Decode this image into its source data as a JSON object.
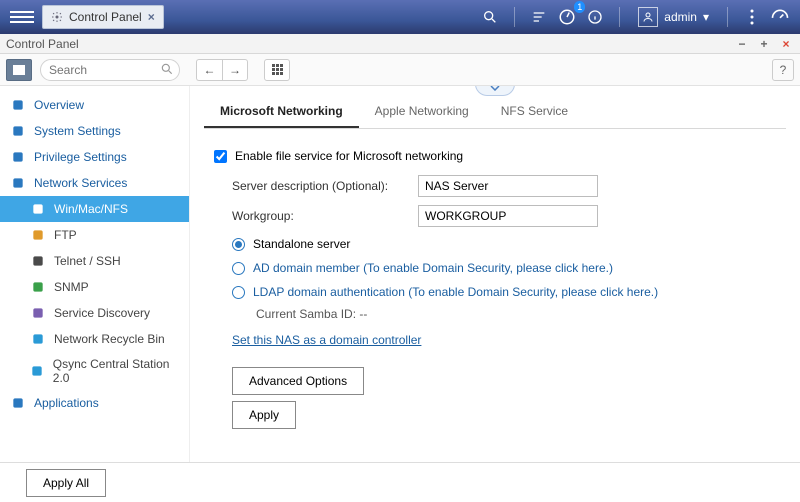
{
  "topbar": {
    "tab_label": "Control Panel",
    "user_name": "admin",
    "notif_count": "1"
  },
  "window_title": "Control Panel",
  "navstrip": {
    "search_placeholder": "Search"
  },
  "sidebar": {
    "items": [
      {
        "label": "Overview",
        "kind": "top"
      },
      {
        "label": "System Settings",
        "kind": "top"
      },
      {
        "label": "Privilege Settings",
        "kind": "top"
      },
      {
        "label": "Network Services",
        "kind": "top"
      },
      {
        "label": "Win/Mac/NFS",
        "kind": "sub",
        "selected": true
      },
      {
        "label": "FTP",
        "kind": "sub"
      },
      {
        "label": "Telnet / SSH",
        "kind": "sub"
      },
      {
        "label": "SNMP",
        "kind": "sub"
      },
      {
        "label": "Service Discovery",
        "kind": "sub"
      },
      {
        "label": "Network Recycle Bin",
        "kind": "sub"
      },
      {
        "label": "Qsync Central Station 2.0",
        "kind": "sub"
      },
      {
        "label": "Applications",
        "kind": "top"
      }
    ]
  },
  "tabs": [
    {
      "label": "Microsoft Networking",
      "active": true
    },
    {
      "label": "Apple Networking"
    },
    {
      "label": "NFS Service"
    }
  ],
  "form": {
    "enable_label": "Enable file service for Microsoft networking",
    "enable_checked": true,
    "server_desc_label": "Server description (Optional):",
    "server_desc_value": "NAS Server",
    "workgroup_label": "Workgroup:",
    "workgroup_value": "WORKGROUP",
    "radio_standalone": "Standalone server",
    "radio_ad_prefix": "AD domain member",
    "radio_ad_hint": "(To enable Domain Security, please click here.)",
    "radio_ldap_prefix": "LDAP domain authentication",
    "radio_ldap_hint": "(To enable Domain Security, please click here.)",
    "samba_id_label": "Current Samba ID:",
    "samba_id_value": "--",
    "domain_link": "Set this NAS as a domain controller",
    "advanced_btn": "Advanced Options",
    "apply_btn": "Apply"
  },
  "footer": {
    "apply_all": "Apply All"
  }
}
